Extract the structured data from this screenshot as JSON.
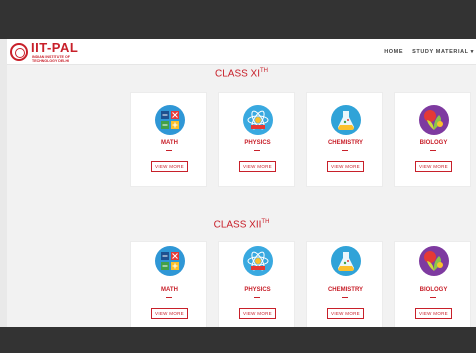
{
  "brand": {
    "title": "IIT-PAL",
    "subtitle": "INDIAN INSTITUTE OF TECHNOLOGY DELHI"
  },
  "nav": {
    "items": [
      "HOME",
      "STUDY MATERIAL ▾"
    ]
  },
  "sections": [
    {
      "title": "CLASS XI",
      "sup": "TH",
      "cards": [
        {
          "label": "MATH",
          "button": "VIEW MORE"
        },
        {
          "label": "PHYSICS",
          "button": "VIEW MORE"
        },
        {
          "label": "CHEMISTRY",
          "button": "VIEW MORE"
        },
        {
          "label": "BIOLOGY",
          "button": "VIEW MORE"
        }
      ]
    },
    {
      "title": "CLASS XII",
      "sup": "TH",
      "cards": [
        {
          "label": "MATH",
          "button": "VIEW MORE"
        },
        {
          "label": "PHYSICS",
          "button": "VIEW MORE"
        },
        {
          "label": "CHEMISTRY",
          "button": "VIEW MORE"
        },
        {
          "label": "BIOLOGY",
          "button": "VIEW MORE"
        }
      ]
    }
  ],
  "colors": {
    "accent": "#c8202a",
    "frame": "#333333",
    "background": "#f2f2f2"
  },
  "icons": {
    "math": "math-operators-icon",
    "physics": "atom-icon",
    "chemistry": "flask-icon",
    "biology": "plant-icon"
  }
}
